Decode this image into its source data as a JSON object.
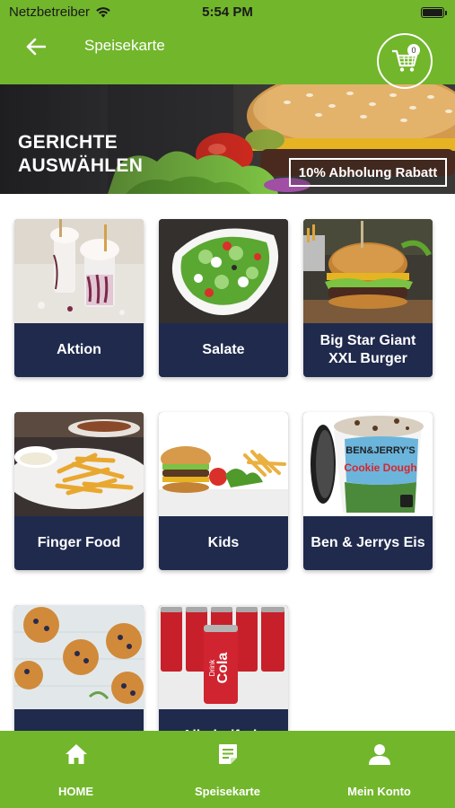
{
  "status_bar": {
    "carrier": "Netzbetreiber",
    "time": "5:54 PM"
  },
  "header": {
    "title": "Speisekarte",
    "cart_count": "0",
    "icons": {
      "back": "arrow-left-icon",
      "cart": "shopping-cart-icon"
    }
  },
  "hero": {
    "title": "GERICHTE AUSWÄHLEN",
    "promo": "10% Abholung Rabatt"
  },
  "categories": [
    {
      "label": "Aktion"
    },
    {
      "label": "Salate"
    },
    {
      "label": "Big Star Giant XXL Burger"
    },
    {
      "label": "Finger Food"
    },
    {
      "label": "Kids"
    },
    {
      "label": "Ben & Jerrys Eis"
    },
    {
      "label": ""
    },
    {
      "label": "Alkoholfreie"
    }
  ],
  "product_text": {
    "ice_cream_brand": "BEN&JERRY'S",
    "ice_cream_flavor": "Cookie Dough",
    "cola": "Cola",
    "drink": "Drink"
  },
  "tab_bar": {
    "tabs": [
      {
        "label": "HOME",
        "icon": "home-icon"
      },
      {
        "label": "Speisekarte",
        "icon": "menu-document-icon"
      },
      {
        "label": "Mein Konto",
        "icon": "account-icon"
      }
    ]
  },
  "colors": {
    "brand_green": "#72b62c",
    "card_navy": "#1f2a4d"
  }
}
